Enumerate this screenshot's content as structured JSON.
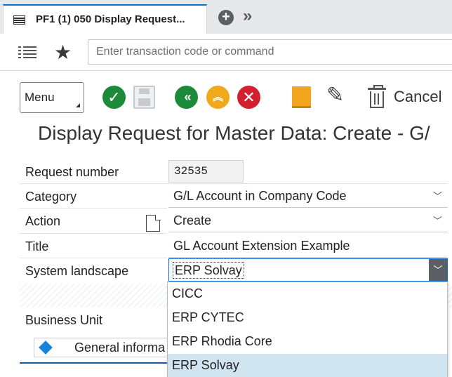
{
  "tab": {
    "title": "PF1 (1) 050 Display Request...",
    "add_glyph": "+",
    "more_glyph": "»"
  },
  "command": {
    "placeholder": "Enter transaction code or command"
  },
  "toolbar": {
    "menu_label": "Menu",
    "cancel_label": "Cancel",
    "icons": [
      "check-icon",
      "save-icon",
      "back-icon",
      "exit-icon",
      "cancel-icon",
      "note-icon",
      "edit-icon",
      "delete-icon"
    ]
  },
  "page": {
    "title": "Display Request for Master Data: Create - G/"
  },
  "form": {
    "request_number": {
      "label": "Request number",
      "value": "32535"
    },
    "category": {
      "label": "Category",
      "value": "G/L Account in Company Code"
    },
    "action": {
      "label": "Action",
      "value": "Create"
    },
    "title": {
      "label": "Title",
      "value": "GL Account Extension Example"
    },
    "system_landscape": {
      "label": "System landscape",
      "value": "ERP Solvay"
    },
    "business_unit": {
      "label": "Business Unit"
    },
    "general_info": {
      "label": "General informa"
    }
  },
  "dropdown": {
    "options": [
      "CICC",
      "ERP CYTEC",
      "ERP Rhodia Core",
      "ERP Solvay"
    ],
    "selected_index": 3
  },
  "colors": {
    "accent": "#0a6ed1",
    "check": "#1d8a3a",
    "exit": "#f0a81c",
    "cancel": "#d32030",
    "selection": "#d1e5f1"
  }
}
